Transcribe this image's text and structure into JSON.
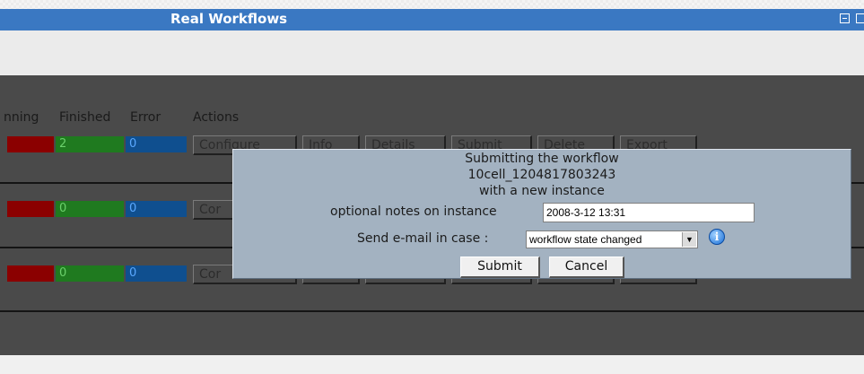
{
  "window": {
    "title": "Real Workflows"
  },
  "table": {
    "headers": {
      "running": "nning",
      "finished": "Finished",
      "error": "Error",
      "actions": "Actions"
    },
    "rows": [
      {
        "running": "",
        "finished": "2",
        "error": "0"
      },
      {
        "running": "",
        "finished": "0",
        "error": "0"
      },
      {
        "running": "",
        "finished": "0",
        "error": "0"
      }
    ],
    "row1_actions": [
      "Configure",
      "Info",
      "Details",
      "Submit",
      "Delete",
      "Export"
    ],
    "row2_visible_action": "Cor",
    "row3_visible_action": "Cor"
  },
  "dialog": {
    "line1": "Submitting the workflow",
    "line2": "10cell_1204817803243",
    "line3": "with a new instance",
    "notes_label": "optional notes on instance",
    "notes_value": "2008-3-12 13:31",
    "email_label": "Send e-mail in case :",
    "email_selected": "workflow state changed",
    "info_icon": "info-icon",
    "submit_label": "Submit",
    "cancel_label": "Cancel"
  },
  "colors": {
    "titlebar": "#3a78c2",
    "running": "#8b0000",
    "finished": "#1f7a1f",
    "error": "#0f4f8f",
    "dialog": "#a3b2c1"
  }
}
